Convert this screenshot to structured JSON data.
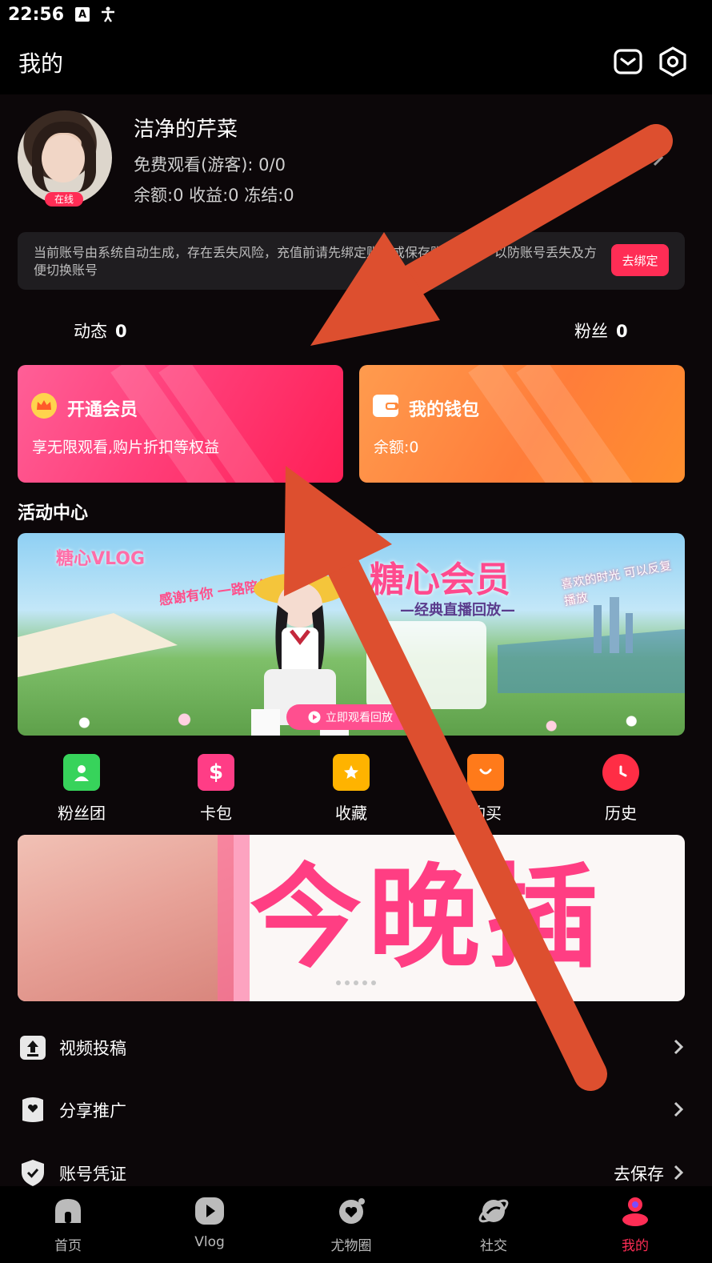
{
  "status_bar": {
    "time": "22:56",
    "icons": [
      "a-badge-icon",
      "accessibility-icon"
    ]
  },
  "header": {
    "title": "我的",
    "icons": [
      "message-icon",
      "settings-icon"
    ]
  },
  "profile": {
    "username": "洁净的芹菜",
    "free_watch": "免费观看(游客): 0/0",
    "balance_line": "余额:0 收益:0 冻结:0",
    "online_badge": "在线"
  },
  "notice": {
    "text": "当前账号由系统自动生成，存在丢失风险，充值前请先绑定账号或保存账号凭证，以防账号丢失及方便切换账号",
    "button": "去绑定"
  },
  "stats": {
    "dynamic_label": "动态",
    "dynamic_value": "0",
    "fans_label": "粉丝",
    "fans_value": "0"
  },
  "cards": {
    "vip": {
      "title": "开通会员",
      "subtitle": "享无限观看,购片折扣等权益",
      "icon": "crown-icon"
    },
    "wallet": {
      "title": "我的钱包",
      "subtitle": "余额:0",
      "icon": "wallet-icon"
    }
  },
  "activity": {
    "section_title": "活动中心",
    "banner": {
      "brand": "糖心VLOG",
      "thanks": "感谢有你 一路陪伴",
      "title": "糖心会员",
      "subtitle": "—经典直播回放—",
      "right_text": "喜欢的时光 可以反复播放",
      "button": "立即观看回放"
    }
  },
  "quick_links": [
    {
      "label": "粉丝团",
      "icon": "fan-club-icon",
      "color": "#37d35b"
    },
    {
      "label": "卡包",
      "icon": "card-pack-icon",
      "color": "#ff3d86"
    },
    {
      "label": "收藏",
      "icon": "favorites-icon",
      "color": "#ffb300"
    },
    {
      "label": "购买",
      "icon": "shopping-bag-icon",
      "color": "#ff7a1a"
    },
    {
      "label": "历史",
      "icon": "history-icon",
      "color": "#ff2d45"
    }
  ],
  "promo_banner": {
    "text": "今晚插",
    "page_count": 5
  },
  "menu": [
    {
      "label": "视频投稿",
      "right": "",
      "icon": "upload-icon"
    },
    {
      "label": "分享推广",
      "right": "",
      "icon": "share-icon"
    },
    {
      "label": "账号凭证",
      "right": "去保存",
      "icon": "shield-icon"
    }
  ],
  "tabs": [
    {
      "label": "首页",
      "icon": "home-icon",
      "active": false
    },
    {
      "label": "Vlog",
      "icon": "play-icon",
      "active": false
    },
    {
      "label": "尤物圈",
      "icon": "heart-planet-icon",
      "active": false
    },
    {
      "label": "社交",
      "icon": "social-planet-icon",
      "active": false
    },
    {
      "label": "我的",
      "icon": "profile-icon",
      "active": true
    }
  ],
  "colors": {
    "accent": "#ff2d55",
    "background": "#0c0709",
    "arrow": "#dd4f2f"
  }
}
